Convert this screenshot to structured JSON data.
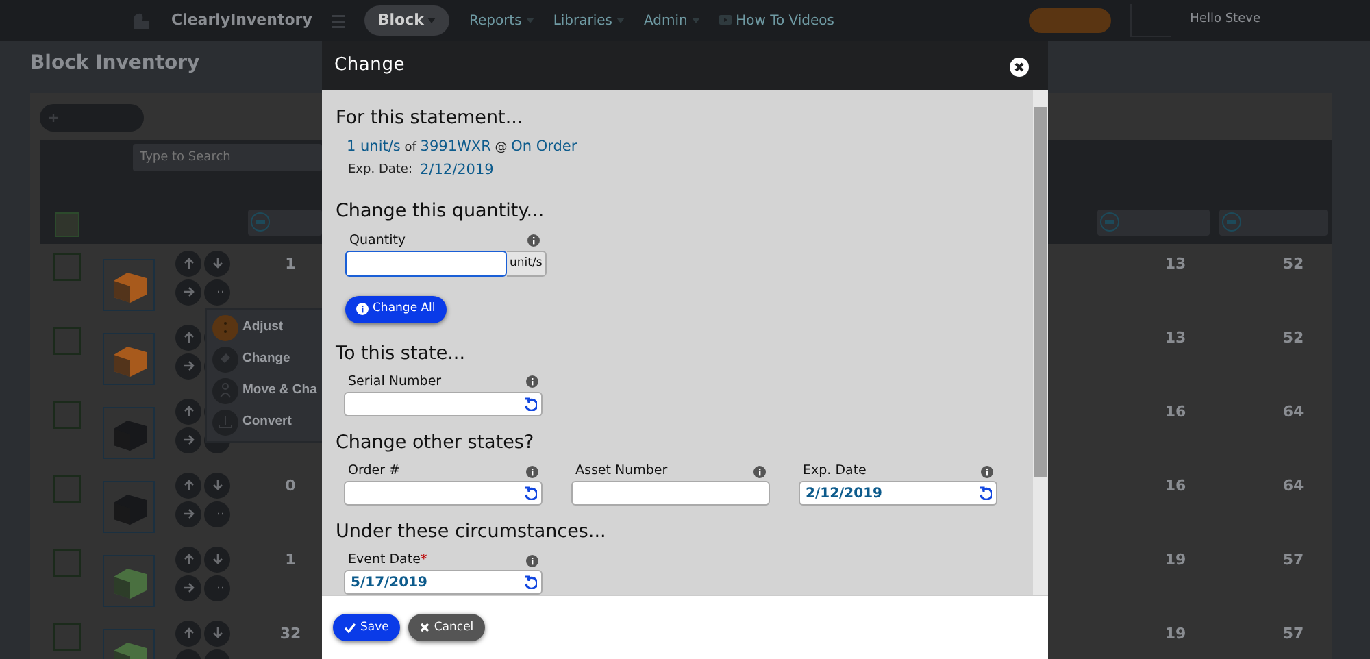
{
  "navbar": {
    "brand": "ClearlyInventory",
    "library_button": "Block",
    "menus": [
      {
        "label": "Reports"
      },
      {
        "label": "Libraries"
      },
      {
        "label": "Admin"
      }
    ],
    "videos_link": "How To Videos",
    "user": "Hello Steve"
  },
  "page": {
    "title": "Block Inventory",
    "search": {
      "placeholder": "Type to Search"
    },
    "select_all_checked": false,
    "rows": [
      {
        "checked": false,
        "color": "#a85a1c",
        "quantity": "1",
        "column_5": "13",
        "column_6": "52"
      },
      {
        "checked": false,
        "color": "#a85a1c",
        "column_5": "13",
        "column_6": "52"
      },
      {
        "checked": false,
        "color": "#17181b",
        "column_5": "16",
        "column_6": "64"
      },
      {
        "checked": false,
        "color": "#17181b",
        "quantity": "0",
        "column_5": "16",
        "column_6": "64"
      },
      {
        "checked": false,
        "color": "#4a7040",
        "quantity": "1",
        "column_5": "19",
        "column_6": "57"
      },
      {
        "checked": false,
        "color": "#4a7040",
        "quantity": "32",
        "column_5": "19",
        "column_6": "57"
      }
    ],
    "action_menu": {
      "items": [
        {
          "label": "Adjust",
          "kind": "adjust"
        },
        {
          "label": "Change",
          "kind": "change"
        },
        {
          "label": "Move & Cha",
          "kind": "move"
        },
        {
          "label": "Convert",
          "kind": "convert"
        }
      ]
    }
  },
  "modal": {
    "title": "Change",
    "statement": {
      "heading": "For this statement...",
      "quantity": "1 unit/s",
      "of": "of",
      "item": "3991WXR",
      "at": "@",
      "state": "On Order",
      "exp_label": "Exp. Date:",
      "exp_value": "2/12/2019"
    },
    "quantity_section": {
      "heading": "Change this quantity...",
      "label": "Quantity",
      "focused": true,
      "unit": "unit/s",
      "change_all": "Change All"
    },
    "sections": [
      {
        "heading": "To this state...",
        "fields": [
          {
            "label": "Serial Number",
            "resettable": true
          }
        ]
      },
      {
        "heading": "Change other states?",
        "fields": [
          {
            "label": "Order #",
            "resettable": true
          },
          {
            "label": "Asset Number",
            "resettable": false
          },
          {
            "label": "Exp. Date",
            "value": "2/12/2019",
            "resettable": true
          }
        ]
      },
      {
        "heading": "Under these circumstances...",
        "fields": [
          {
            "label": "Event Date",
            "required_mark": "*",
            "value": "5/17/2019",
            "resettable": true
          }
        ]
      }
    ],
    "footer": {
      "save": "Save",
      "cancel": "Cancel"
    }
  }
}
